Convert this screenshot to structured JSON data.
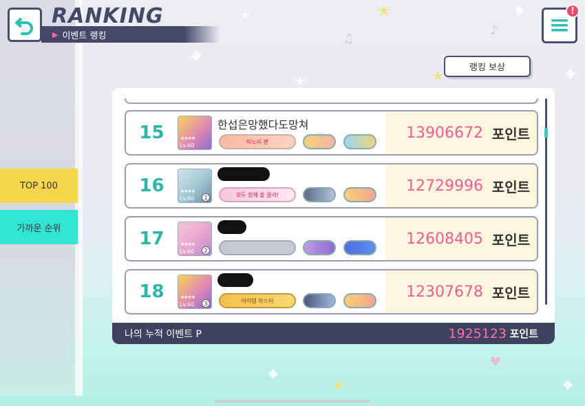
{
  "header": {
    "title": "RANKING",
    "subtitle": "이벤트 랭킹",
    "back_icon": "back-arrow-icon",
    "menu_icon": "hamburger-menu-icon",
    "notification_badge": "!"
  },
  "reward_button": "랭킹 보상",
  "side_tabs": [
    {
      "label": "TOP 100",
      "color": "#f6d64a"
    },
    {
      "label": "가까운 순위",
      "color": "#30e3d3"
    }
  ],
  "rows": [
    {
      "rank": "15",
      "name": "한섭은망했다도망쳐",
      "name_hidden": false,
      "level": "Lv.60",
      "slot": "",
      "title_badge": "미노리 팬",
      "score": "13906672",
      "unit": "포인트"
    },
    {
      "rank": "16",
      "name": "",
      "name_hidden": true,
      "level": "Lv.60",
      "slot": "1",
      "title_badge": "모두 함께 올 클리!",
      "score": "12729996",
      "unit": "포인트"
    },
    {
      "rank": "17",
      "name": "",
      "name_hidden": true,
      "level": "Lv.60",
      "slot": "2",
      "title_badge": "",
      "score": "12608405",
      "unit": "포인트"
    },
    {
      "rank": "18",
      "name": "",
      "name_hidden": true,
      "level": "Lv.60",
      "slot": "3",
      "title_badge": "아이템 마스터",
      "score": "12307678",
      "unit": "포인트"
    }
  ],
  "footer": {
    "label": "나의 누적 이벤트 P",
    "value": "1925123",
    "unit": "포인트"
  },
  "colors": {
    "accent_teal": "#2bb6a8",
    "score_pink": "#f05c95",
    "dark_navy": "#46486a",
    "tab_yellow": "#f6d64a",
    "tab_cyan": "#30e3d3"
  }
}
